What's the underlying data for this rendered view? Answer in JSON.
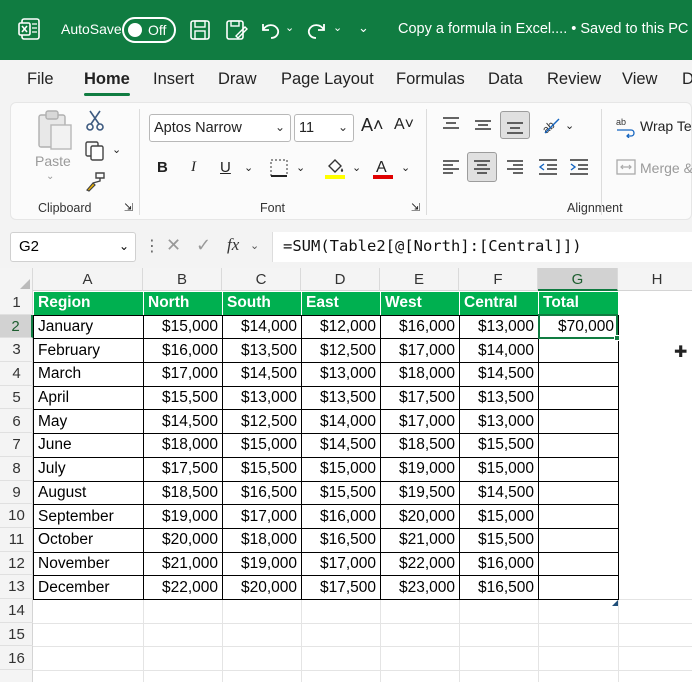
{
  "titlebar": {
    "autosave_label": "AutoSave",
    "toggle_label": "Off",
    "document_title": "Copy a formula in Excel.... • Saved to this PC",
    "accent_color": "#107c41"
  },
  "tabs": [
    "File",
    "Home",
    "Insert",
    "Draw",
    "Page Layout",
    "Formulas",
    "Data",
    "Review",
    "View",
    "D"
  ],
  "ribbon": {
    "paste_label": "Paste",
    "clipboard_label": "Clipboard",
    "font_label": "Font",
    "alignment_label": "Alignment",
    "font_name": "Aptos Narrow",
    "font_size": "11",
    "increase_font": "A˄",
    "decrease_font": "A˅",
    "bold": "B",
    "italic": "I",
    "underline": "U",
    "wrap_text": "Wrap Te",
    "merge": "Merge &"
  },
  "formula_bar": {
    "name_box": "G2",
    "fx": "fx",
    "formula": "=SUM(Table2[@[North]:[Central]])"
  },
  "grid": {
    "columns": [
      "A",
      "B",
      "C",
      "D",
      "E",
      "F",
      "G",
      "H"
    ],
    "rows": [
      "1",
      "2",
      "3",
      "4",
      "5",
      "6",
      "7",
      "8",
      "9",
      "10",
      "11",
      "12",
      "13",
      "14",
      "15",
      "16"
    ],
    "selected_column": "G",
    "selected_row": "2",
    "table_header_color": "#00b050"
  },
  "table": {
    "headers": [
      "Region",
      "North",
      "South",
      "East",
      "West",
      "Central",
      "Total"
    ],
    "rows": [
      [
        "January",
        "$15,000",
        "$14,000",
        "$12,000",
        "$16,000",
        "$13,000",
        "$70,000"
      ],
      [
        "February",
        "$16,000",
        "$13,500",
        "$12,500",
        "$17,000",
        "$14,000",
        ""
      ],
      [
        "March",
        "$17,000",
        "$14,500",
        "$13,000",
        "$18,000",
        "$14,500",
        ""
      ],
      [
        "April",
        "$15,500",
        "$13,000",
        "$13,500",
        "$17,500",
        "$13,500",
        ""
      ],
      [
        "May",
        "$14,500",
        "$12,500",
        "$14,000",
        "$17,000",
        "$13,000",
        ""
      ],
      [
        "June",
        "$18,000",
        "$15,000",
        "$14,500",
        "$18,500",
        "$15,500",
        ""
      ],
      [
        "July",
        "$17,500",
        "$15,500",
        "$15,000",
        "$19,000",
        "$15,000",
        ""
      ],
      [
        "August",
        "$18,500",
        "$16,500",
        "$15,500",
        "$19,500",
        "$14,500",
        ""
      ],
      [
        "September",
        "$19,000",
        "$17,000",
        "$16,000",
        "$20,000",
        "$15,000",
        ""
      ],
      [
        "October",
        "$20,000",
        "$18,000",
        "$16,500",
        "$21,000",
        "$15,500",
        ""
      ],
      [
        "November",
        "$21,000",
        "$19,000",
        "$17,000",
        "$22,000",
        "$16,000",
        ""
      ],
      [
        "December",
        "$22,000",
        "$20,000",
        "$17,500",
        "$23,000",
        "$16,500",
        ""
      ]
    ]
  }
}
